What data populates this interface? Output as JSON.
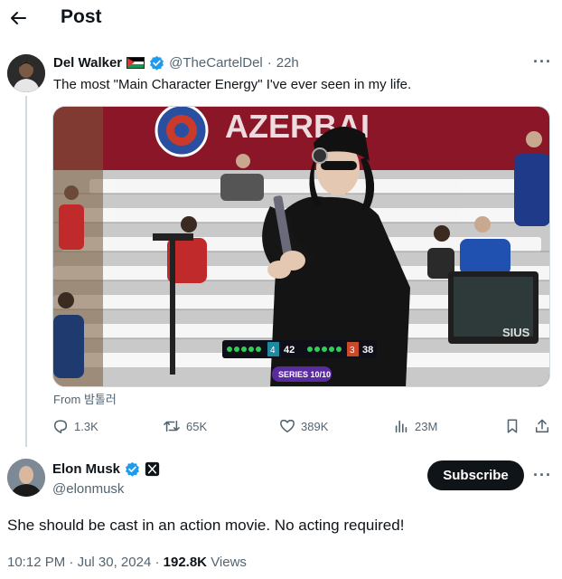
{
  "header": {
    "title": "Post"
  },
  "quoted_post": {
    "display_name": "Del Walker",
    "handle": "@TheCartelDel",
    "time": "22h",
    "text": "The most \"Main Character Energy\" I've ever seen in my life.",
    "media": {
      "banner_text": "AZERBAI",
      "scoreboard": {
        "left_score": "42",
        "right_score": "38",
        "left_sets": "4",
        "right_sets": "3",
        "series": "SERIES 10/10"
      },
      "sign_text": "SIUS"
    },
    "from": "From 밤톨러",
    "stats": {
      "replies": "1.3K",
      "reposts": "65K",
      "likes": "389K",
      "views": "23M"
    }
  },
  "reply": {
    "display_name": "Elon Musk",
    "handle": "@elonmusk",
    "subscribe_label": "Subscribe",
    "text": "She should be cast in an action movie. No  acting required!",
    "time": "10:12 PM",
    "date": "Jul 30, 2024",
    "views_count": "192.8K",
    "views_label": "Views"
  },
  "colors": {
    "text": "#0f1419",
    "secondary": "#536471",
    "verified": "#1d9bf0",
    "banner": "#8a1628"
  }
}
